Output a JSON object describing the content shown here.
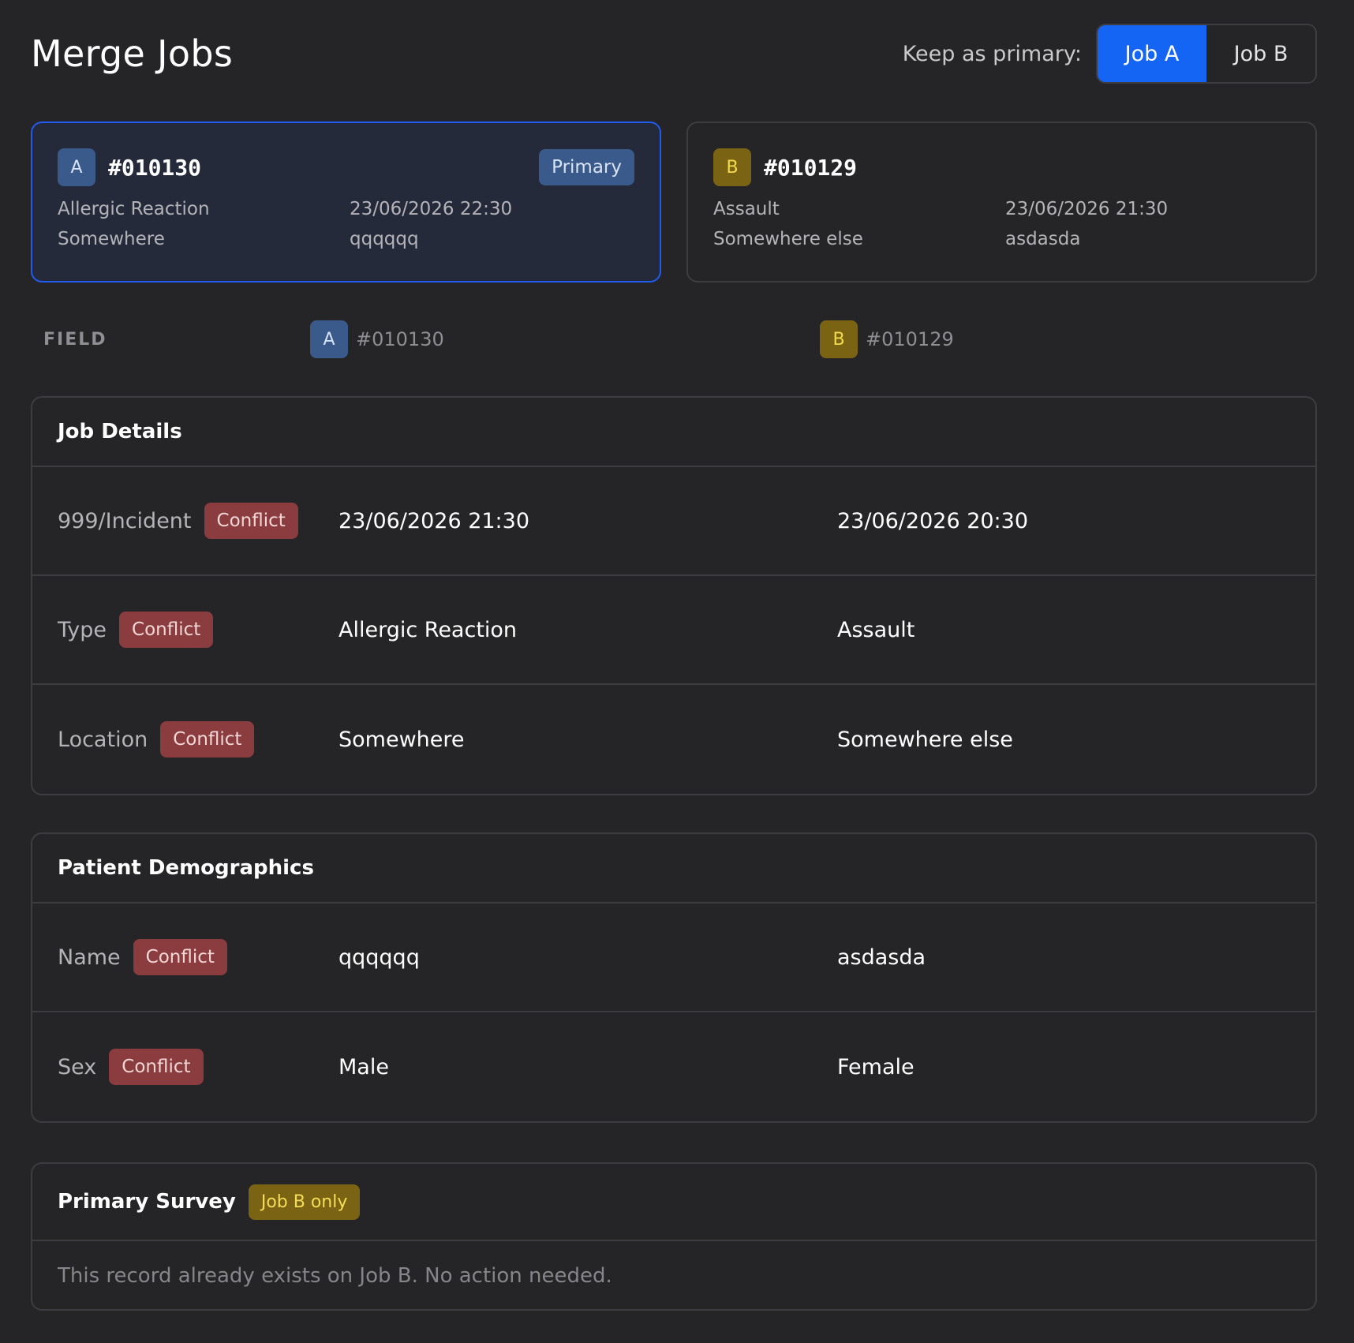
{
  "header": {
    "title": "Merge Jobs",
    "keep_primary_label": "Keep as primary:",
    "options": [
      "Job A",
      "Job B"
    ],
    "selected": "Job A"
  },
  "jobs": {
    "a": {
      "letter": "A",
      "id": "#010130",
      "badge": "Primary",
      "type": "Allergic Reaction",
      "datetime": "23/06/2026 22:30",
      "location": "Somewhere",
      "name": "qqqqqq"
    },
    "b": {
      "letter": "B",
      "id": "#010129",
      "type": "Assault",
      "datetime": "23/06/2026 21:30",
      "location": "Somewhere else",
      "name": "asdasda"
    }
  },
  "columns": {
    "field_label": "FIELD",
    "a_letter": "A",
    "a_id": "#010130",
    "b_letter": "B",
    "b_id": "#010129"
  },
  "sections": {
    "job_details": {
      "title": "Job Details",
      "rows": [
        {
          "field": "999/Incident",
          "badge": "Conflict",
          "a": "23/06/2026 21:30",
          "b": "23/06/2026 20:30"
        },
        {
          "field": "Type",
          "badge": "Conflict",
          "a": "Allergic Reaction",
          "b": "Assault"
        },
        {
          "field": "Location",
          "badge": "Conflict",
          "a": "Somewhere",
          "b": "Somewhere else"
        }
      ]
    },
    "patient_demographics": {
      "title": "Patient Demographics",
      "rows": [
        {
          "field": "Name",
          "badge": "Conflict",
          "a": "qqqqqq",
          "b": "asdasda"
        },
        {
          "field": "Sex",
          "badge": "Conflict",
          "a": "Male",
          "b": "Female"
        }
      ]
    },
    "primary_survey": {
      "title": "Primary Survey",
      "badge": "Job B only",
      "note": "This record already exists on Job B. No action needed."
    }
  },
  "colors": {
    "accent": "#1565f5",
    "background": "#252527",
    "conflict": "#8a3c3e",
    "job_a": "#3a5a8c",
    "job_b": "#7a6414"
  }
}
